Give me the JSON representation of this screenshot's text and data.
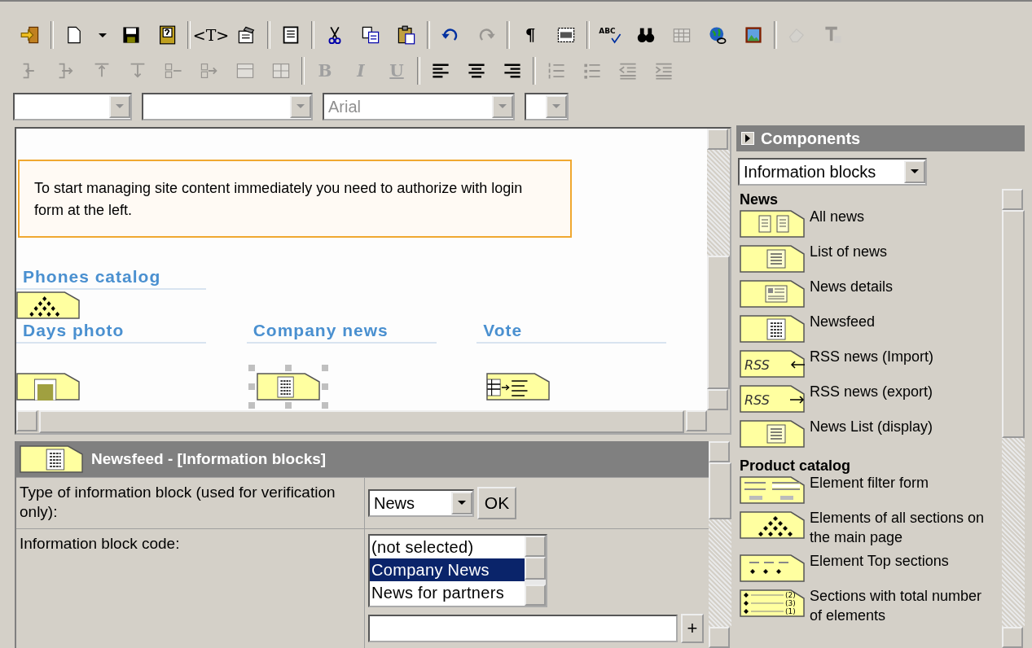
{
  "toolbar_rows": [
    [
      {
        "kind": "exit",
        "disabled": false
      },
      {
        "kind": "sep"
      },
      {
        "kind": "new",
        "disabled": false
      },
      {
        "kind": "dropdown",
        "disabled": false
      },
      {
        "kind": "save",
        "disabled": false
      },
      {
        "kind": "save-as",
        "disabled": false
      },
      {
        "kind": "sep"
      },
      {
        "kind": "tag",
        "label": "<T>",
        "disabled": false
      },
      {
        "kind": "properties",
        "disabled": false
      },
      {
        "kind": "sep"
      },
      {
        "kind": "page",
        "disabled": false
      },
      {
        "kind": "sep"
      },
      {
        "kind": "cut",
        "disabled": false
      },
      {
        "kind": "copy",
        "disabled": false
      },
      {
        "kind": "paste",
        "disabled": false
      },
      {
        "kind": "sep"
      },
      {
        "kind": "undo",
        "disabled": false
      },
      {
        "kind": "redo",
        "disabled": true
      },
      {
        "kind": "sep"
      },
      {
        "kind": "pilcrow",
        "label": "¶",
        "disabled": false
      },
      {
        "kind": "frame",
        "disabled": false
      },
      {
        "kind": "sep"
      },
      {
        "kind": "spell",
        "label": "ABC",
        "disabled": false
      },
      {
        "kind": "find",
        "disabled": false
      },
      {
        "kind": "table",
        "disabled": true
      },
      {
        "kind": "link",
        "disabled": false
      },
      {
        "kind": "image",
        "disabled": false
      },
      {
        "kind": "sep"
      },
      {
        "kind": "eraser",
        "disabled": true
      },
      {
        "kind": "clear-format",
        "disabled": true
      }
    ],
    [
      {
        "kind": "col-left",
        "disabled": true
      },
      {
        "kind": "col-right",
        "disabled": true
      },
      {
        "kind": "row-up",
        "disabled": true
      },
      {
        "kind": "row-down",
        "disabled": true
      },
      {
        "kind": "cell-left",
        "disabled": true
      },
      {
        "kind": "cell-right",
        "disabled": true
      },
      {
        "kind": "merge",
        "disabled": true
      },
      {
        "kind": "split",
        "disabled": true
      },
      {
        "kind": "sep"
      },
      {
        "kind": "bold",
        "label": "B",
        "disabled": true
      },
      {
        "kind": "italic",
        "label": "I",
        "disabled": true
      },
      {
        "kind": "underline",
        "label": "U",
        "disabled": true
      },
      {
        "kind": "sep"
      },
      {
        "kind": "align-left",
        "disabled": false
      },
      {
        "kind": "align-center",
        "disabled": false
      },
      {
        "kind": "align-right",
        "disabled": false
      },
      {
        "kind": "sep"
      },
      {
        "kind": "ordered-list",
        "disabled": true
      },
      {
        "kind": "bullet-list",
        "disabled": true
      },
      {
        "kind": "outdent",
        "disabled": true
      },
      {
        "kind": "indent",
        "disabled": true
      }
    ]
  ],
  "selects": [
    {
      "kind": "style",
      "disabled": true
    },
    {
      "kind": "format",
      "disabled": true
    },
    {
      "kind": "font",
      "value": "Arial",
      "disabled": true
    },
    {
      "kind": "size",
      "disabled": true
    }
  ],
  "editor": {
    "notice": "To start managing site content immediately you need to authorize with login form at the left.",
    "rows": [
      [
        {
          "title": "Phones catalog",
          "kind": "diamonds",
          "selected": false
        }
      ],
      [
        {
          "title": "Days photo",
          "kind": "photo",
          "selected": false
        },
        {
          "title": "Company news",
          "kind": "feed",
          "selected": true
        },
        {
          "title": "Vote",
          "kind": "vote",
          "selected": false
        }
      ]
    ]
  },
  "properties": {
    "kind": "feed",
    "title": "Newsfeed - [Information blocks]",
    "rows": [
      {
        "kind": "select",
        "label": "Type of information block (used for verification only):",
        "value": "News",
        "button": "OK"
      },
      {
        "kind": "listbox",
        "label": "Information block code:",
        "options": [
          {
            "text": "(not selected)",
            "selected": false
          },
          {
            "text": "Company News",
            "selected": true
          },
          {
            "text": "News for partners",
            "selected": false
          }
        ],
        "add_button": "+"
      }
    ]
  },
  "components": {
    "title": "Components",
    "filter": "Information blocks",
    "groups": [
      {
        "name": "News",
        "items": [
          {
            "kind": "all",
            "label": "All news"
          },
          {
            "kind": "list",
            "label": "List of news"
          },
          {
            "kind": "detail",
            "label": "News details"
          },
          {
            "kind": "feed",
            "label": "Newsfeed"
          },
          {
            "kind": "rss-in",
            "badge": "RSS",
            "label": "RSS news (Import)"
          },
          {
            "kind": "rss-out",
            "badge": "RSS",
            "label": "RSS news (export)"
          },
          {
            "kind": "list",
            "label": "News List (display)"
          }
        ]
      },
      {
        "name": "Product catalog",
        "items": [
          {
            "kind": "filter",
            "label": "Element filter form"
          },
          {
            "kind": "diamonds",
            "label": "Elements of all sections on the main page"
          },
          {
            "kind": "dots",
            "label": "Element Top sections"
          },
          {
            "kind": "numbered",
            "marks": [
              "(2)",
              "(3)",
              "(1)"
            ],
            "label": "Sections with total number of elements"
          }
        ]
      }
    ]
  }
}
